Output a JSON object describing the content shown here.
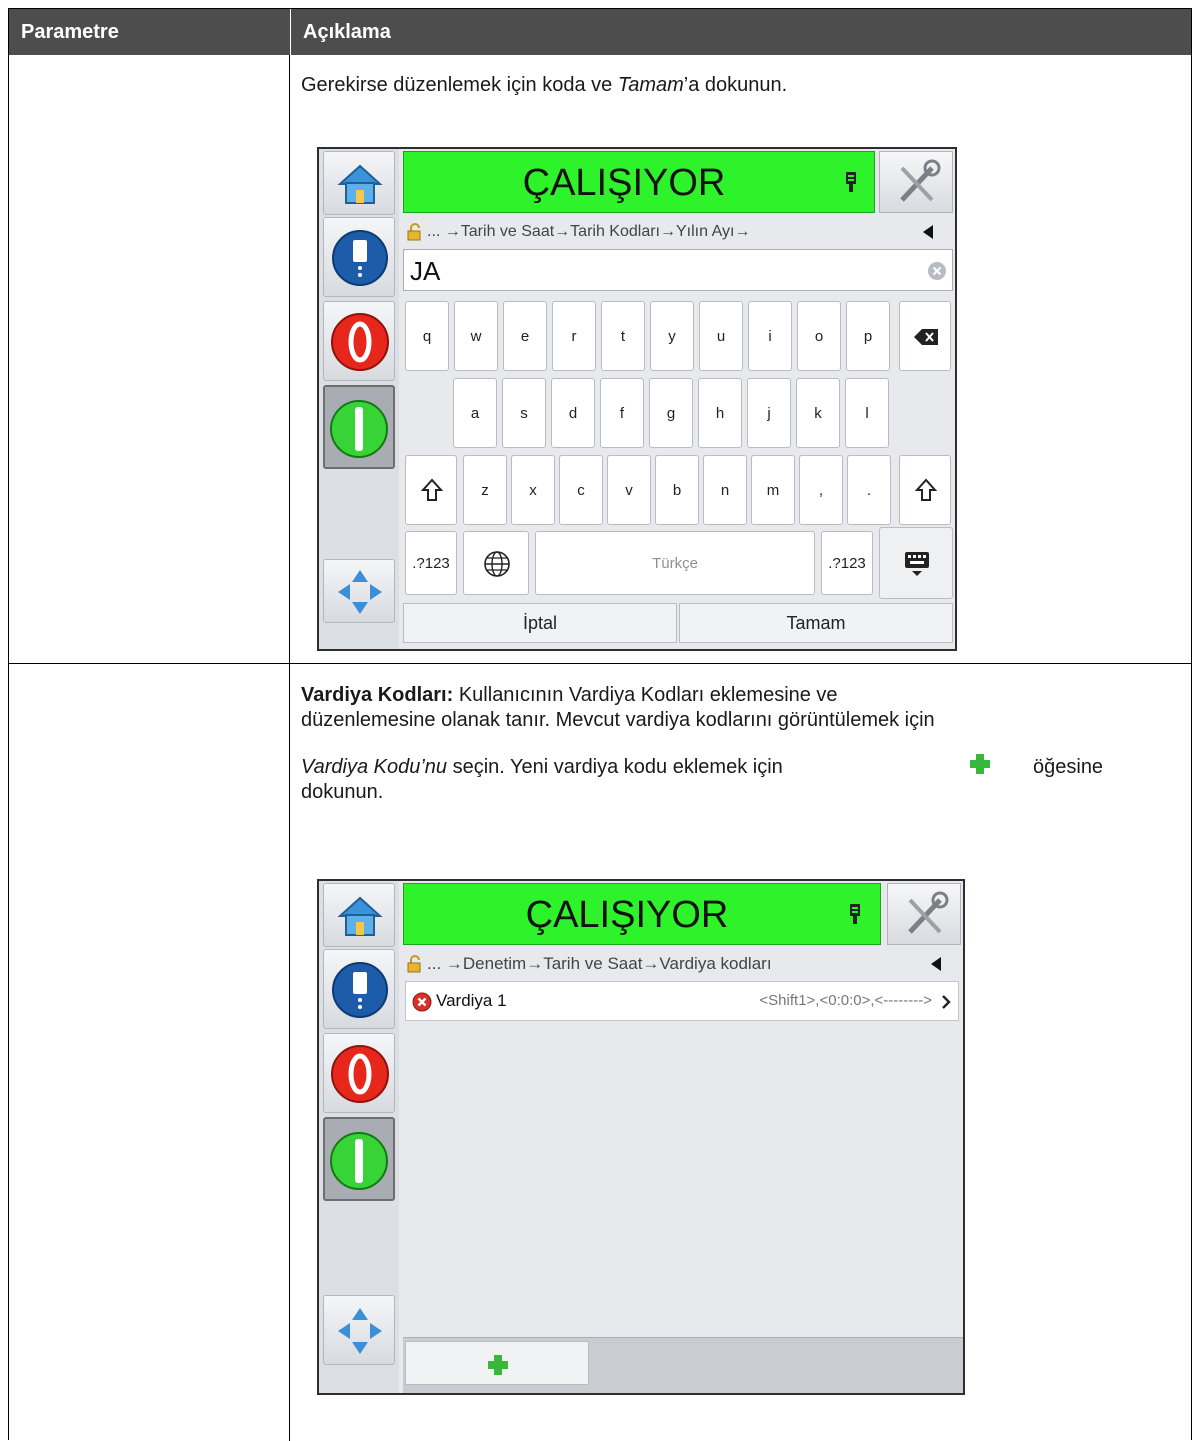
{
  "table": {
    "header": {
      "col1": "Parametre",
      "col2": "Açıklama"
    }
  },
  "row1": {
    "text_before": "Gerekirse düzenlemek için koda ve ",
    "text_italic": "Tamam",
    "text_after": "’a dokunun."
  },
  "screen1": {
    "status": "ÇALIŞIYOR",
    "breadcrumb": "... →Tarih ve Saat→Tarih Kodları→Yılın Ayı→",
    "input_value": "JA",
    "keys_row1": [
      "q",
      "w",
      "e",
      "r",
      "t",
      "y",
      "u",
      "i",
      "o",
      "p"
    ],
    "keys_row2": [
      "a",
      "s",
      "d",
      "f",
      "g",
      "h",
      "j",
      "k",
      "l"
    ],
    "keys_row3": [
      "z",
      "x",
      "c",
      "v",
      "b",
      "n",
      "m",
      ",",
      "."
    ],
    "num_key": ".?123",
    "space_label": "Türkçe",
    "cancel": "İptal",
    "ok": "Tamam"
  },
  "row2": {
    "bold": "Vardiya Kodları:",
    "line1": " Kullanıcının Vardiya Kodları eklemesine ve",
    "line2": "düzenlemesine olanak tanır. Mevcut vardiya kodlarını görüntülemek için",
    "line3_italic": "Vardiya Kodu’nu",
    "line3_rest": " seçin. Yeni vardiya kodu eklemek için",
    "line3_end": "öğesine",
    "line4": "dokunun."
  },
  "screen2": {
    "status": "ÇALIŞIYOR",
    "breadcrumb": "... →Denetim→Tarih ve Saat→Vardiya kodları",
    "item_label": "Vardiya 1",
    "item_value": "<Shift1>,<0:0:0>,<-------->"
  },
  "colors": {
    "header_bg": "#4d4d4d",
    "status_green": "#2ef32a",
    "stop_red": "#e8271c",
    "plus_green": "#38b83a"
  }
}
